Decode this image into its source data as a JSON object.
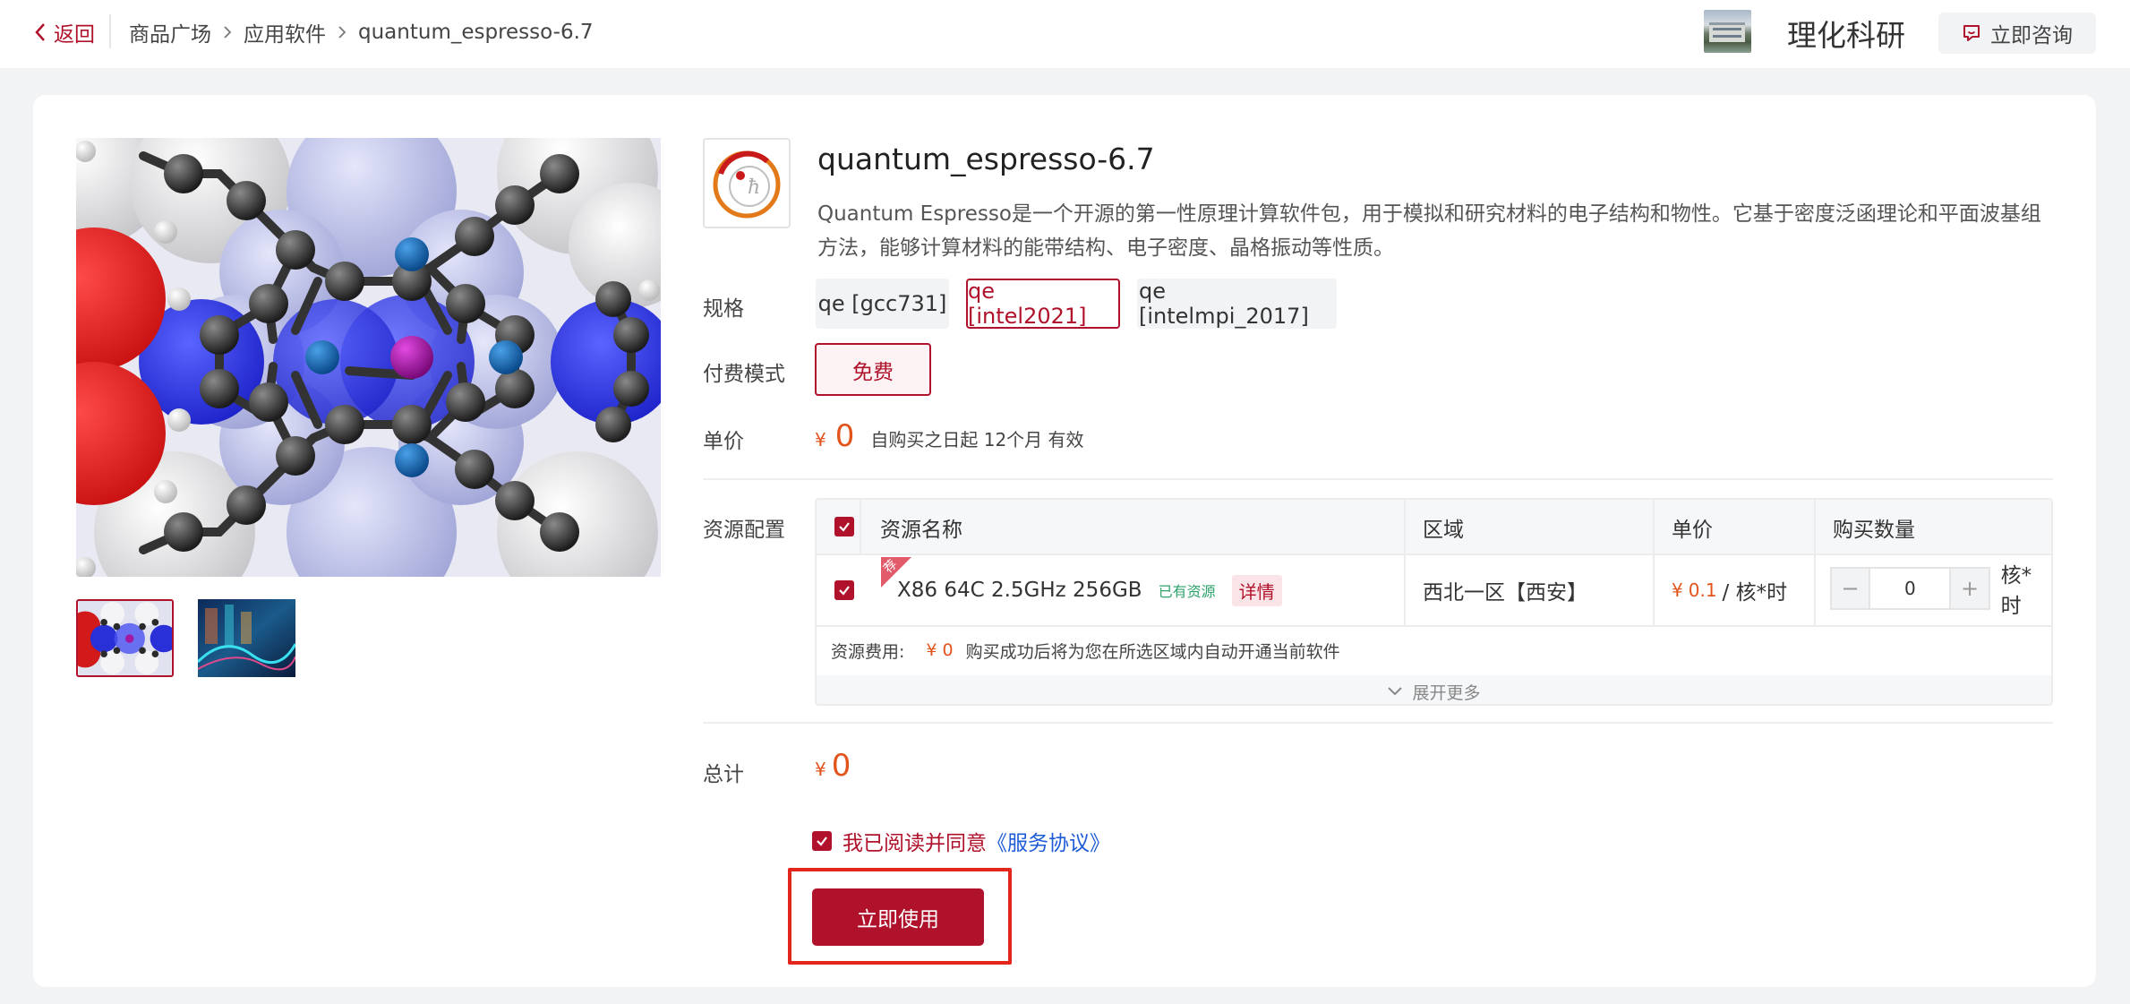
{
  "topbar": {
    "back_label": "返回",
    "breadcrumbs": [
      "商品广场",
      "应用软件",
      "quantum_espresso-6.7"
    ],
    "org_name": "理化科研",
    "consult_label": "立即咨询"
  },
  "product": {
    "title": "quantum_espresso-6.7",
    "description": "Quantum Espresso是一个开源的第一性原理计算软件包，用于模拟和研究材料的电子结构和物性。它基于密度泛函理论和平面波基组方法，能够计算材料的能带结构、电子密度、晶格振动等性质。"
  },
  "form": {
    "spec_label": "规格",
    "specs": [
      "qe [gcc731]",
      "qe [intel2021]",
      "qe [intelmpi_2017]"
    ],
    "selected_spec": "qe [intel2021]",
    "paymode_label": "付费模式",
    "paymode_value": "免费",
    "price_label": "单价",
    "currency": "¥",
    "price_value": "0",
    "validity": "自购买之日起 12个月 有效",
    "resource_label": "资源配置",
    "total_label": "总计",
    "total_value": "0"
  },
  "resource_table": {
    "headers": [
      "资源名称",
      "区域",
      "单价",
      "购买数量"
    ],
    "rows": [
      {
        "tag": "荐",
        "name": "X86 64C 2.5GHz 256GB",
        "availability": "已有资源",
        "detail_label": "详情",
        "region": "西北一区【西安】",
        "unit_price_value": "0.1",
        "unit_price_unit": "/ 核*时",
        "quantity": "0",
        "quantity_unit": "核*时",
        "checked": true
      }
    ],
    "fee_label": "资源费用:",
    "fee_value": "¥ 0",
    "fee_note": "购买成功后将为您在所选区域内自动开通当前软件",
    "expand_label": "展开更多"
  },
  "agreement": {
    "text": "我已阅读并同意",
    "link": "《服务协议》",
    "checked": true
  },
  "actions": {
    "use_label": "立即使用"
  },
  "colors": {
    "brand": "#b0122b",
    "price": "#e2541b",
    "link": "#1e5bd7",
    "highlight": "#e3261b"
  },
  "icons": {
    "back": "chevron-left-icon",
    "breadcrumb_sep": "chevron-right-icon",
    "consult": "chat-icon",
    "expand": "chevron-down-icon"
  }
}
